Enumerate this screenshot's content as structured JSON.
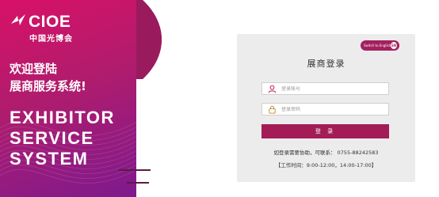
{
  "brand": {
    "logo_text": "CIOE",
    "logo_sub": "中国光博会",
    "accent": "#a31c56",
    "hero_gradient": [
      "#d81168",
      "#7e1a8e"
    ]
  },
  "hero": {
    "welcome_line1": "欢迎登陆",
    "welcome_line2": "展商服务系统!",
    "big_line1": "EXHIBITOR",
    "big_line2": "SERVICE",
    "big_line3": "SYSTEM"
  },
  "login": {
    "lang_label": "Switch to English",
    "lang_code": "EN",
    "title": "展商登录",
    "username_placeholder": "登录账号",
    "password_placeholder": "登录密码",
    "submit_label": "登 录",
    "help_text": "如登录需要协助，可联系：  0755-88242583",
    "hours_text": "【工作时间：9:00-12:00，14:00-17:00】"
  },
  "icons": {
    "user": "user-icon",
    "lock": "lock-icon"
  }
}
